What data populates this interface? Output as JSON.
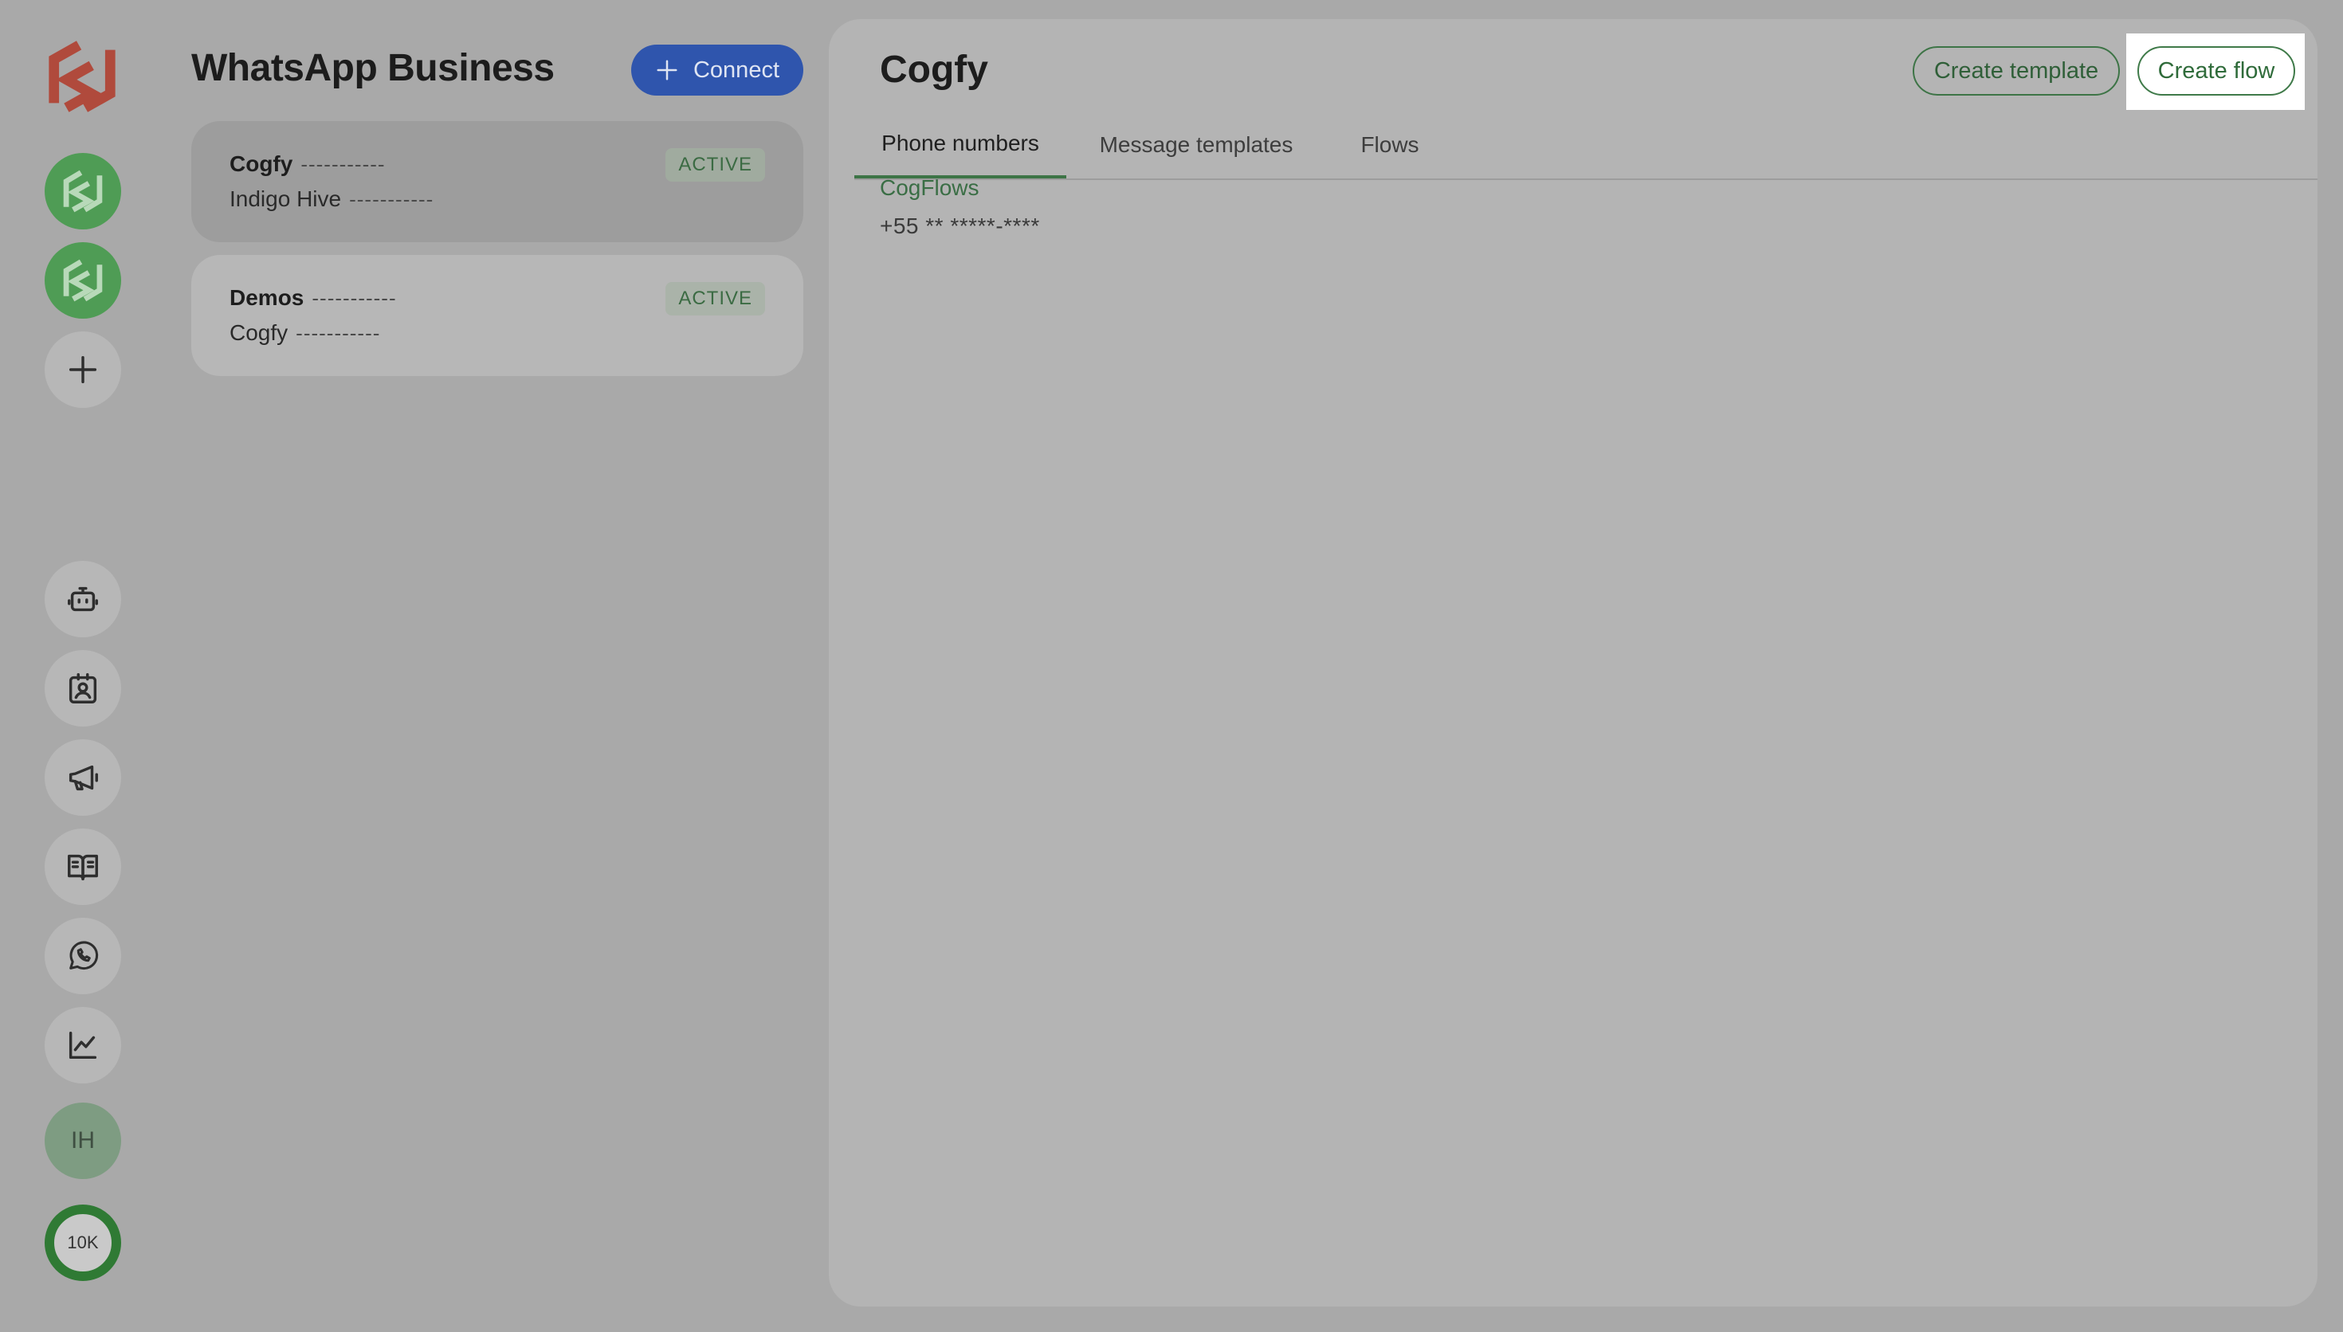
{
  "rail": {
    "logo": "brand-logo-icon",
    "workspaces": [
      "workspace-logo-icon",
      "workspace-logo-icon"
    ],
    "add": "plus-icon",
    "nav": [
      {
        "id": "agents",
        "icon": "robot-icon"
      },
      {
        "id": "contacts",
        "icon": "contact-badge-icon"
      },
      {
        "id": "campaigns",
        "icon": "megaphone-icon"
      },
      {
        "id": "knowledge",
        "icon": "book-icon"
      },
      {
        "id": "whatsapp",
        "icon": "whatsapp-icon"
      },
      {
        "id": "analytics",
        "icon": "chart-icon"
      }
    ],
    "avatar_initials": "IH",
    "credits": "10K"
  },
  "accounts": {
    "title": "WhatsApp Business",
    "connect_label": "Connect",
    "items": [
      {
        "name": "Cogfy",
        "name_mask": "-----------",
        "sub": "Indigo Hive",
        "sub_mask": "-----------",
        "status": "ACTIVE"
      },
      {
        "name": "Demos",
        "name_mask": "-----------",
        "sub": "Cogfy",
        "sub_mask": "-----------",
        "status": "ACTIVE"
      }
    ]
  },
  "main": {
    "title": "Cogfy",
    "create_template_label": "Create template",
    "create_flow_label": "Create flow",
    "tabs": [
      {
        "label": "Phone numbers",
        "active": true
      },
      {
        "label": "Message templates",
        "active": false
      },
      {
        "label": "Flows",
        "active": false
      }
    ],
    "phone": {
      "name": "CogFlows",
      "number": "+55 ** *****-****"
    }
  },
  "colors": {
    "accent_green": "#3d7446",
    "connect_blue": "#2f55ad",
    "brand_red": "#b04a3c"
  }
}
